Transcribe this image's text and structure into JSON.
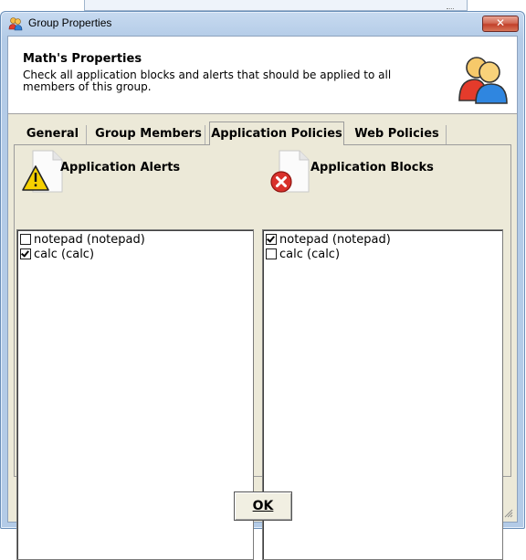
{
  "window": {
    "title": "Group Properties",
    "close_label": "✕"
  },
  "header": {
    "title": "Math's Properties",
    "description": "Check all application blocks and alerts that should be applied to all members of this group."
  },
  "tabs": [
    {
      "label": "General",
      "active": false
    },
    {
      "label": "Group Members",
      "active": false
    },
    {
      "label": "Application Policies",
      "active": true
    },
    {
      "label": "Web Policies",
      "active": false
    }
  ],
  "alerts": {
    "title": "Application Alerts",
    "items": [
      {
        "label": "notepad (notepad)",
        "checked": false
      },
      {
        "label": "calc (calc)",
        "checked": true
      }
    ]
  },
  "blocks": {
    "title": "Application Blocks",
    "items": [
      {
        "label": "notepad (notepad)",
        "checked": true
      },
      {
        "label": "calc (calc)",
        "checked": false
      }
    ]
  },
  "footer": {
    "ok_label": "OK"
  },
  "colors": {
    "title_bar": "#b9d1ea",
    "close_button": "#c7503a",
    "dialog_face": "#ece9d8",
    "warning_yellow": "#f5d000",
    "error_red": "#d9312b"
  },
  "icons": {
    "title": "group-people-icon",
    "header": "group-people-icon",
    "alerts": "warning-document-icon",
    "blocks": "error-document-icon"
  }
}
